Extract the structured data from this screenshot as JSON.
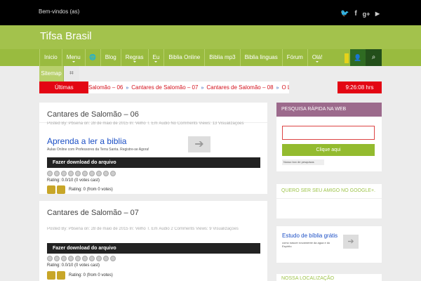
{
  "topbar": {
    "welcome": "Bem-vindos (as)",
    "social": [
      "twitter-icon",
      "facebook-icon",
      "googleplus-icon",
      "youtube-icon"
    ]
  },
  "header": {
    "site_title": "Tifsa Brasil"
  },
  "nav": {
    "items": [
      {
        "label": "Inicio",
        "dropdown": false
      },
      {
        "label": "Menu",
        "dropdown": true
      },
      {
        "label": "",
        "dropdown": false,
        "icon": "globe-icon"
      },
      {
        "label": "Blog",
        "dropdown": false
      },
      {
        "label": "Regras",
        "dropdown": true
      },
      {
        "label": "Eu",
        "dropdown": true
      },
      {
        "label": "Biblia Online",
        "dropdown": false
      },
      {
        "label": "Biblia mp3",
        "dropdown": false
      },
      {
        "label": "Biblia linguas",
        "dropdown": false
      },
      {
        "label": "Fórum",
        "dropdown": false
      },
      {
        "label": "Olá!",
        "dropdown": true
      }
    ],
    "row2_label": "Sitemap",
    "user_icon": "user-icon",
    "search_icon": "search-icon"
  },
  "ticker": {
    "label": "Últimas",
    "items": [
      "Salomão – 06",
      "Cantares de Salomão – 07",
      "Cantares de Salomão – 08",
      "O Livro de"
    ],
    "clock": "9:26:08 hrs"
  },
  "posts": [
    {
      "title": "Cantares de Salomão – 06",
      "meta": "Posted By: Pbsena   on: 28 de maio de 2015   In: Velho T. Em Áudio   No Comments   Views: 13 Visualizações",
      "ad_title": "Aprenda a ler a biblia",
      "ad_sub": "Aulas Online com Professores da Terra Santa. Registre-se Agora!",
      "download": "Fazer download do arquivo",
      "rating": "Rating: 0.0/10 (0 votes cast)",
      "rating2": "Rating: 0 (from 0 votes)"
    },
    {
      "title": "Cantares de Salomão – 07",
      "meta": "Posted By: Pbsena   on: 28 de maio de 2015   In: Velho T. Em Áudio   2 Comments   Views: 9 Visualizações",
      "download": "Fazer download do arquivo",
      "rating": "Rating: 0.0/10 (0 votes cast)",
      "rating2": "Rating: 0 (from 0 votes)"
    }
  ],
  "sidebar": {
    "search_title": "PESQUISA RÁPIDA NA WEB",
    "search_button": "Clique aqui",
    "search_brand": "Nosso box de pesquisas",
    "friend_title": "QUERO SER SEU AMIGO NO GOOGLE+.",
    "ad_title": "Estudo de bíblia grátis",
    "ad_sub": "como nascer novamente da agua e do Espírito",
    "location_title": "NOSSA LOCALIZAÇÃO"
  },
  "colors": {
    "nav": "#99bb3f",
    "header": "#a3c24c",
    "ticker": "#e30613",
    "sidebar_head": "#9c6a8c"
  }
}
